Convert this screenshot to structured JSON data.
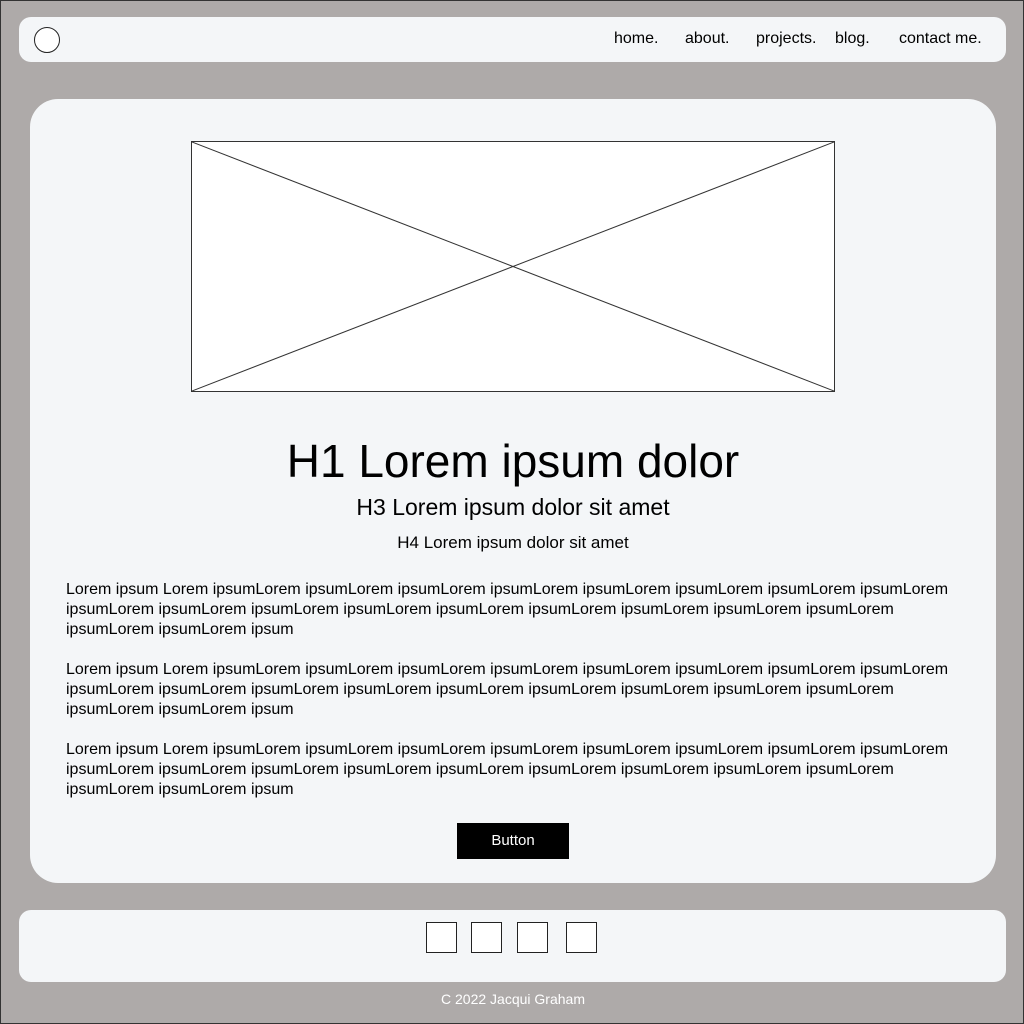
{
  "header": {
    "nav": [
      "home.",
      "about.",
      "projects.",
      "blog.",
      "contact me."
    ]
  },
  "main": {
    "h1": "H1 Lorem ipsum dolor",
    "h3": "H3 Lorem ipsum dolor sit amet",
    "h4": "H4 Lorem ipsum dolor sit amet",
    "paragraphs": [
      "Lorem ipsum Lorem ipsumLorem ipsumLorem ipsumLorem ipsumLorem ipsumLorem ipsumLorem ipsumLorem ipsumLorem ipsumLorem ipsumLorem ipsumLorem ipsumLorem ipsumLorem ipsumLorem ipsumLorem ipsumLorem ipsumLorem ipsumLorem ipsumLorem ipsum",
      "Lorem ipsum Lorem ipsumLorem ipsumLorem ipsumLorem ipsumLorem ipsumLorem ipsumLorem ipsumLorem ipsumLorem ipsumLorem ipsumLorem ipsumLorem ipsumLorem ipsumLorem ipsumLorem ipsumLorem ipsumLorem ipsumLorem ipsumLorem ipsumLorem ipsum",
      "Lorem ipsum Lorem ipsumLorem ipsumLorem ipsumLorem ipsumLorem ipsumLorem ipsumLorem ipsumLorem ipsumLorem ipsumLorem ipsumLorem ipsumLorem ipsumLorem ipsumLorem ipsumLorem ipsumLorem ipsumLorem ipsumLorem ipsumLorem ipsumLorem ipsum"
    ],
    "button_label": "Button"
  },
  "footer": {
    "copyright": "C 2022 Jacqui Graham"
  },
  "colors": {
    "page_background": "#aeaaa9",
    "panel_background": "#f4f6f8",
    "button_background": "#000000",
    "button_text": "#ffffff"
  },
  "icons": {
    "logo": "circle-logo-icon",
    "hero": "image-placeholder-icon",
    "social": [
      "social-link-icon",
      "social-link-icon",
      "social-link-icon",
      "social-link-icon"
    ]
  }
}
